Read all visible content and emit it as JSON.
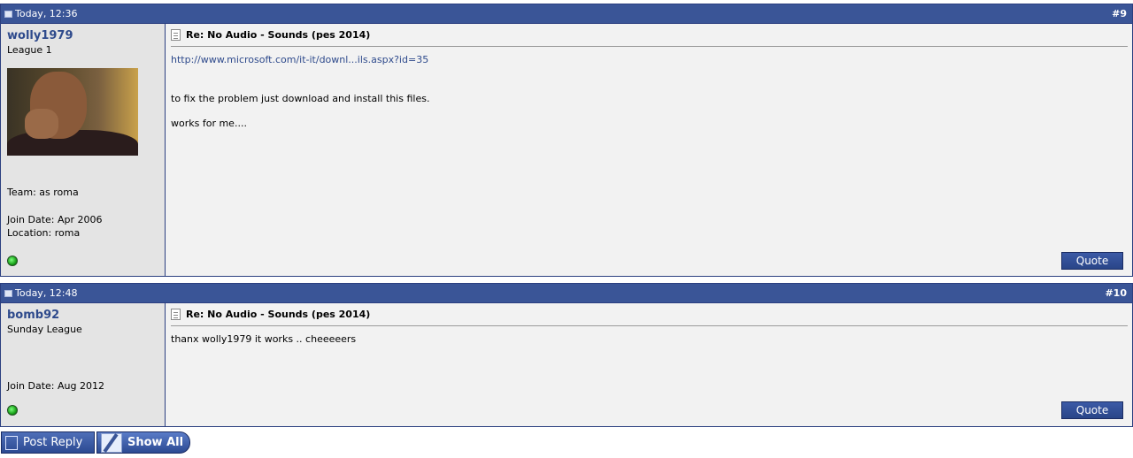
{
  "posts": [
    {
      "date": "Today, 12:36",
      "number": "#9",
      "username": "wolly1979",
      "user_title": "League 1",
      "info_team": "Team: as roma",
      "info_join": "Join Date: Apr 2006",
      "info_location": "Location: roma",
      "title": "Re: No Audio - Sounds (pes 2014)",
      "link": "http://www.microsoft.com/it-it/downl...ils.aspx?id=35",
      "lines": [
        "to fix the problem just download and install this files.",
        "works for me...."
      ],
      "quote_label": "Quote"
    },
    {
      "date": "Today, 12:48",
      "number": "#10",
      "username": "bomb92",
      "user_title": "Sunday League",
      "info_join": "Join Date: Aug 2012",
      "title": "Re: No Audio - Sounds (pes 2014)",
      "lines": [
        "thanx wolly1979 it works .. cheeeeers"
      ],
      "quote_label": "Quote"
    }
  ],
  "buttons": {
    "post_reply": "Post Reply",
    "show_all": "Show All"
  },
  "colors": {
    "header_bg": "#3a5597",
    "link": "#2e4a8c",
    "sidebar_bg": "#e4e4e4",
    "post_bg": "#f2f2f2"
  }
}
